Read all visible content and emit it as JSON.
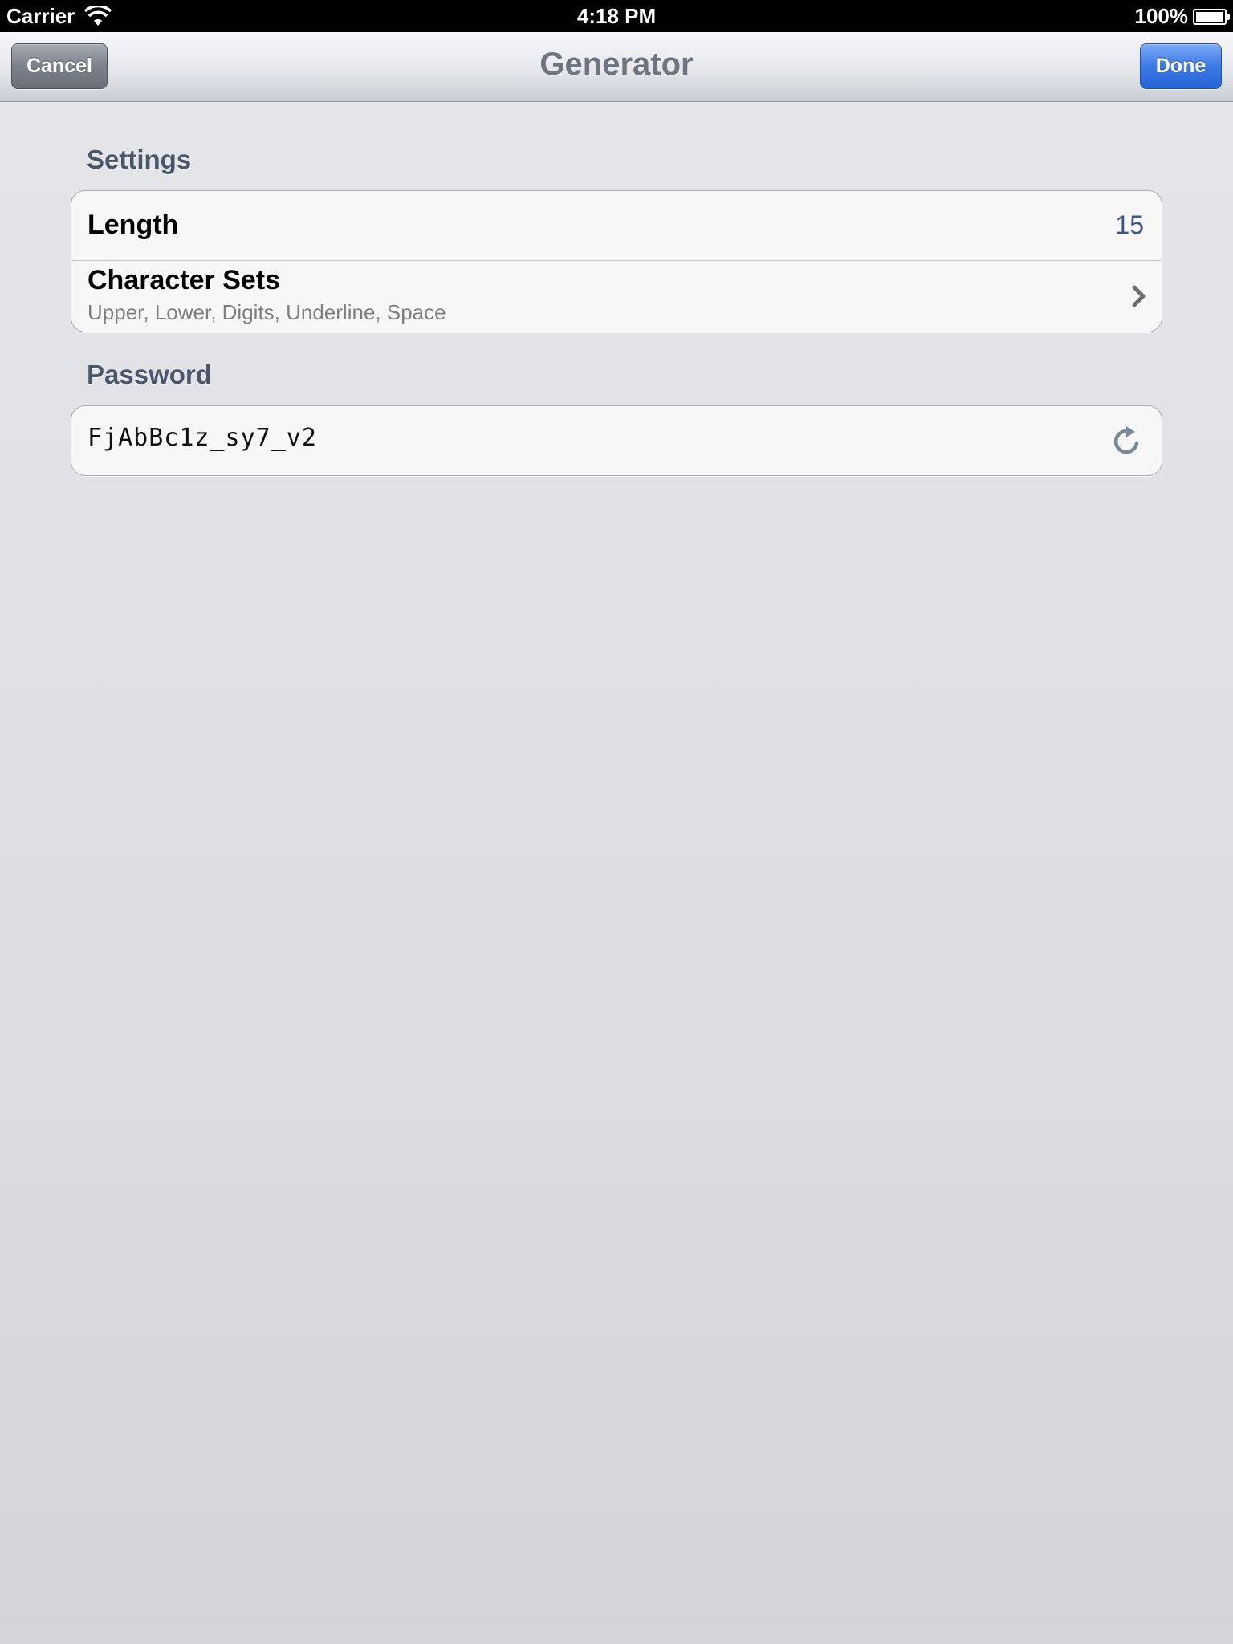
{
  "status_bar": {
    "carrier": "Carrier",
    "time": "4:18 PM",
    "battery": "100%",
    "wifi_icon": "wifi-icon",
    "battery_icon": "battery-icon"
  },
  "nav": {
    "title": "Generator",
    "cancel_label": "Cancel",
    "done_label": "Done"
  },
  "settings": {
    "header": "Settings",
    "length_label": "Length",
    "length_value": "15",
    "charsets_label": "Character Sets",
    "charsets_value": "Upper, Lower, Digits, Underline, Space",
    "charsets_icon": "chevron-right-icon"
  },
  "password": {
    "header": "Password",
    "value": "FjAbBc1z_sy7_v2",
    "refresh_icon": "refresh-icon"
  },
  "colors": {
    "accent_blue": "#3b7ae8",
    "value_blue": "#385487",
    "header_text": "#4c566a"
  }
}
